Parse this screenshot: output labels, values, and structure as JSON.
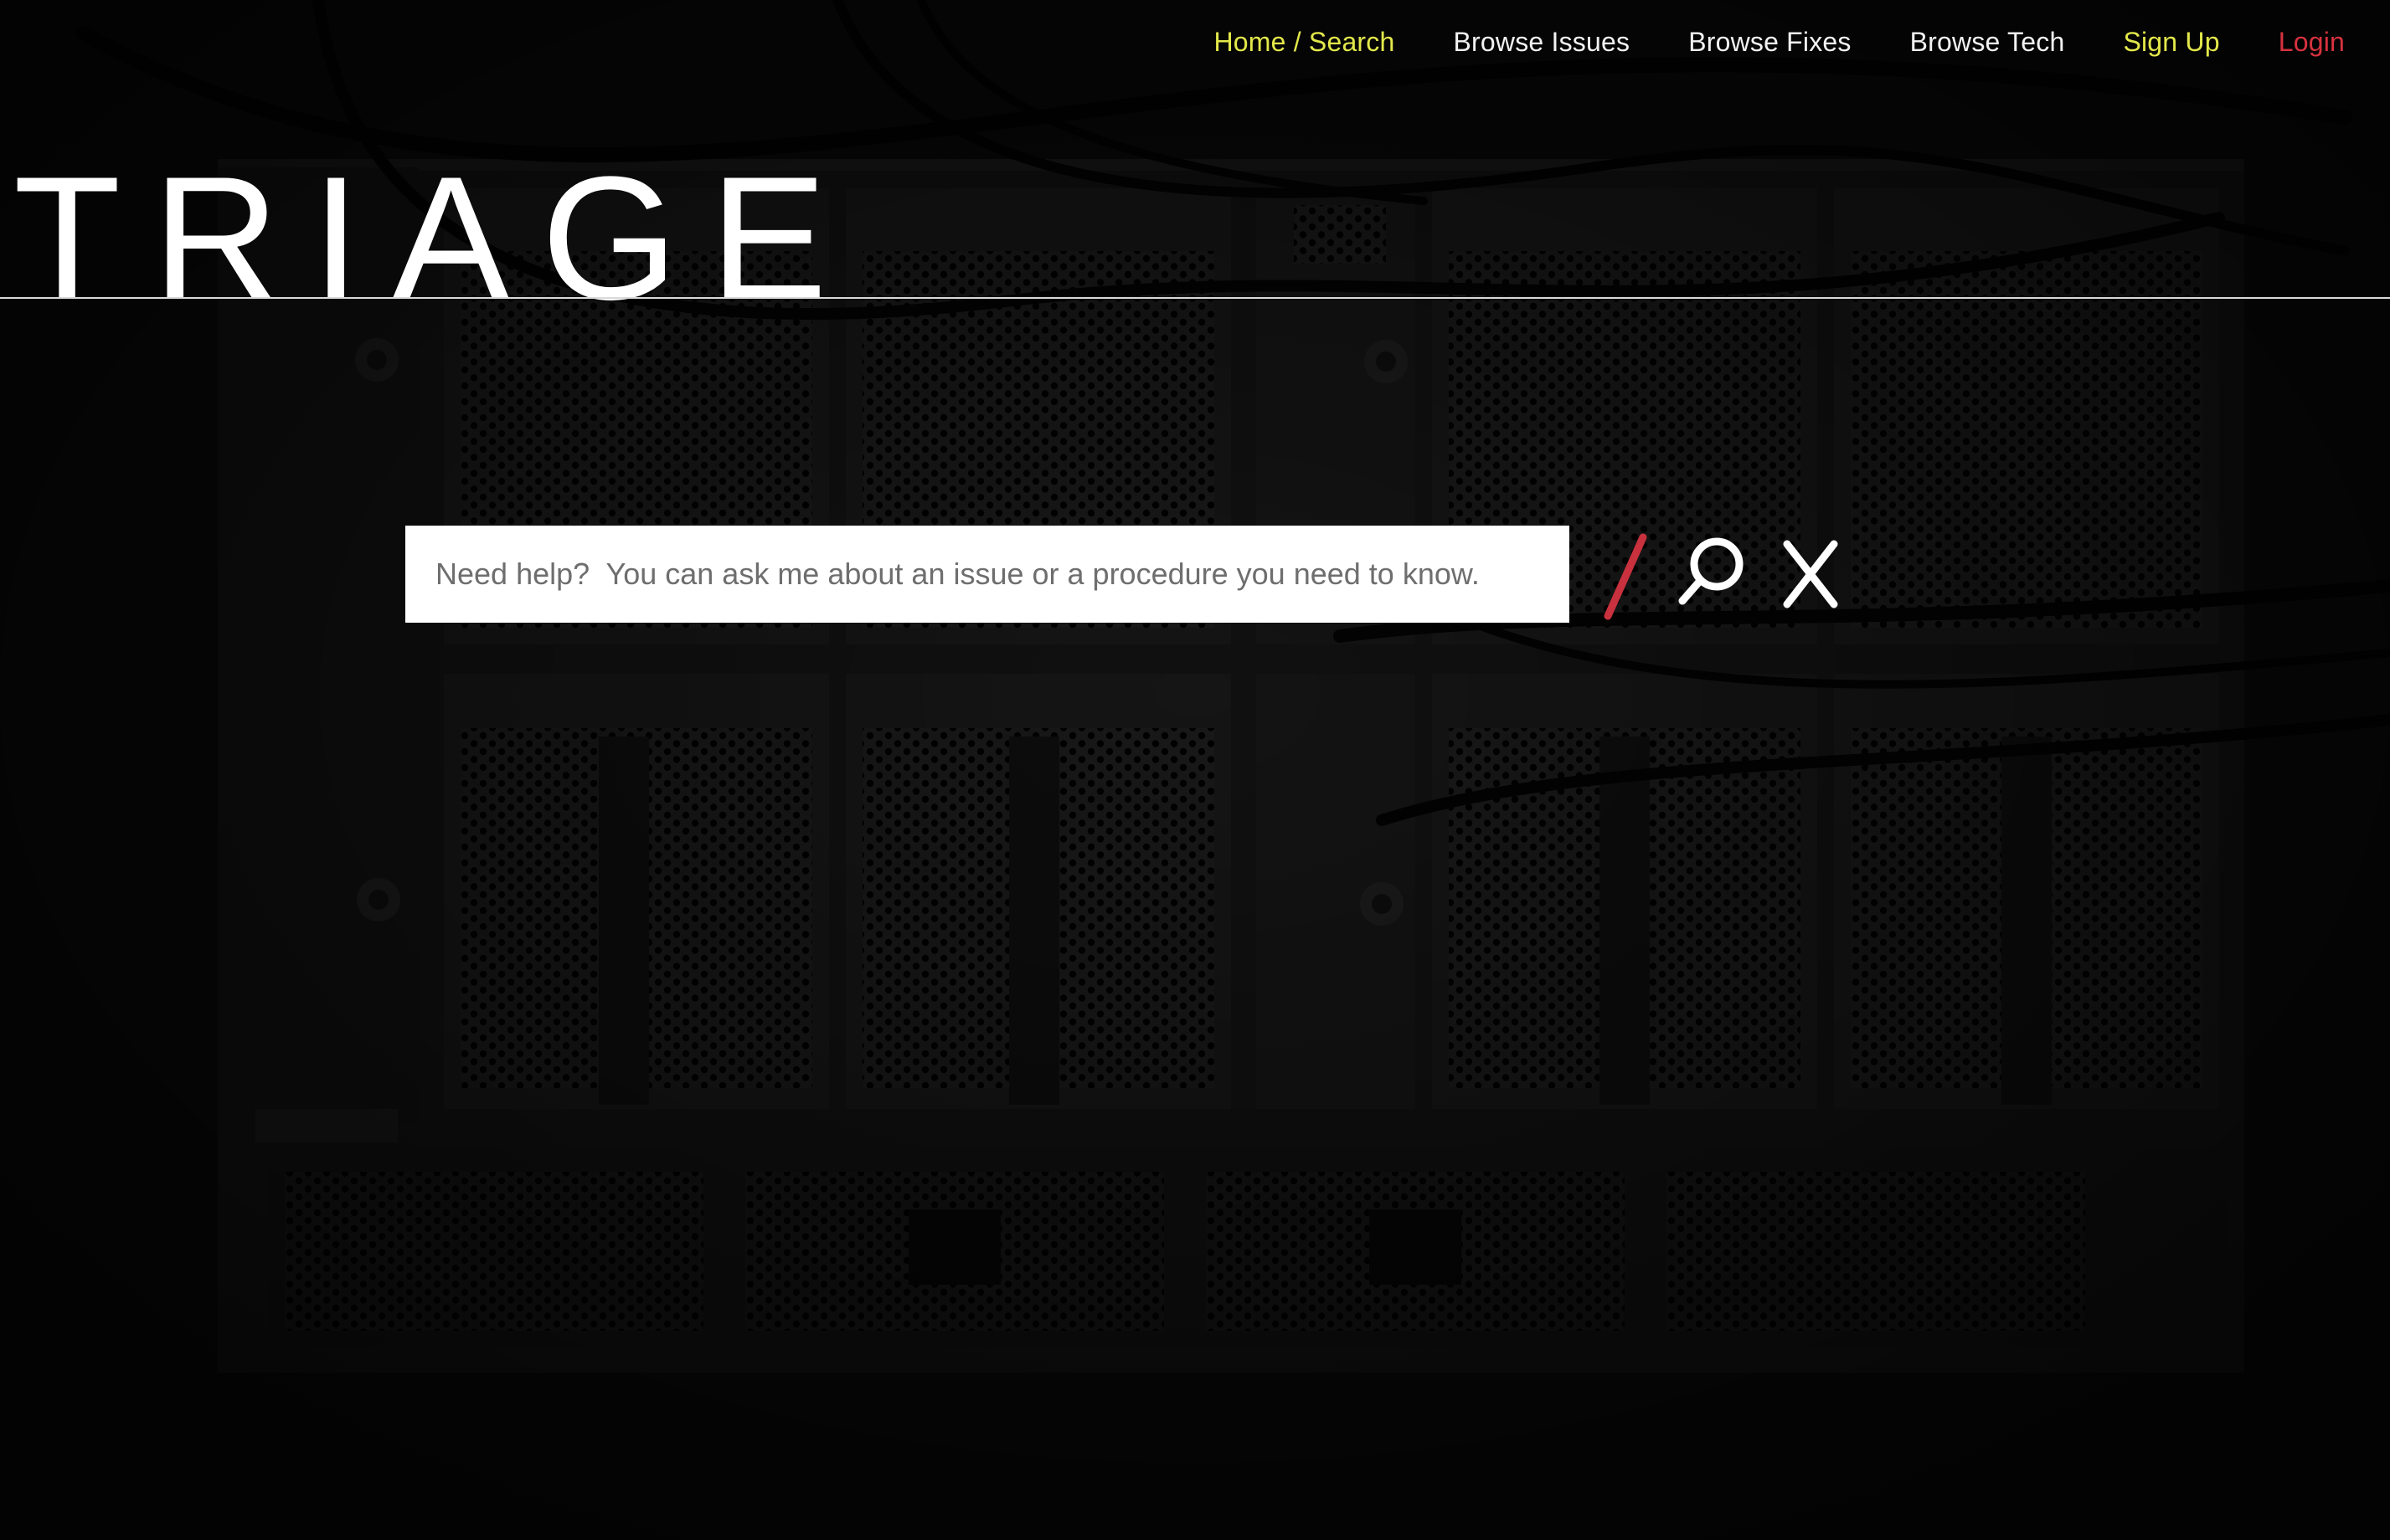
{
  "nav": {
    "items": [
      {
        "label": "Home / Search",
        "state": "active"
      },
      {
        "label": "Browse Issues"
      },
      {
        "label": "Browse Fixes"
      },
      {
        "label": "Browse Tech"
      },
      {
        "label": "Sign Up"
      },
      {
        "label": "Login"
      }
    ]
  },
  "brand": {
    "title": "TRIAGE"
  },
  "search": {
    "placeholder": "Need help?  You can ask me about an issue or a procedure you need to know.",
    "value": ""
  },
  "icons": {
    "divider": "slash-icon",
    "submit": "search-icon",
    "clear": "close-icon"
  },
  "colors": {
    "background": "#0d0d0d",
    "nav_text": "#f2f2f2",
    "nav_active": "#e3e84a",
    "signup": "#e3e84a",
    "login": "#d7323f",
    "slash_accent": "#c8313d",
    "brand_text": "#ffffff"
  }
}
